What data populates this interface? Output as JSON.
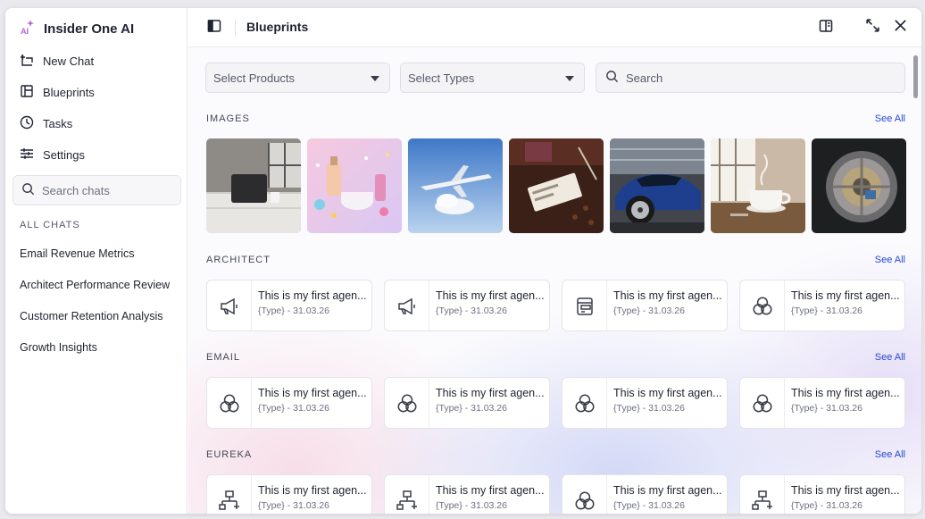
{
  "sidebar": {
    "brand_name": "Insider One AI",
    "nav": [
      {
        "label": "New Chat",
        "icon": "new-chat-icon"
      },
      {
        "label": "Blueprints",
        "icon": "blueprints-icon"
      },
      {
        "label": "Tasks",
        "icon": "clock-icon"
      },
      {
        "label": "Settings",
        "icon": "sliders-icon"
      }
    ],
    "search_placeholder": "Search chats",
    "chats_label": "ALL CHATS",
    "chats": [
      "Email Revenue Metrics",
      "Architect Performance Review",
      "Customer Retention Analysis",
      "Growth Insights"
    ]
  },
  "header": {
    "title": "Blueprints"
  },
  "filters": {
    "products_placeholder": "Select Products",
    "types_placeholder": "Select Types",
    "search_placeholder": "Search"
  },
  "sections": {
    "images": {
      "title": "IMAGES",
      "see_all": "See All"
    },
    "architect": {
      "title": "ARCHITECT",
      "see_all": "See All"
    },
    "email": {
      "title": "EMAIL",
      "see_all": "See All"
    },
    "eureka": {
      "title": "EUREKA",
      "see_all": "See All"
    }
  },
  "images": [
    "speaker-on-counter",
    "cosmetics-confetti",
    "airplane-in-sky",
    "tickets-on-table",
    "blue-sports-car",
    "coffee-cup-steam",
    "vault-door"
  ],
  "cards": {
    "title": "This is my first agen...",
    "subtitle": "{Type} - 31.03.26",
    "architect_icons": [
      "megaphone-icon",
      "megaphone-icon",
      "form-icon",
      "circles-icon"
    ],
    "email_icons": [
      "circles-icon",
      "circles-icon",
      "circles-icon",
      "circles-icon"
    ],
    "eureka_icons": [
      "flow-icon",
      "flow-icon",
      "circles-icon",
      "flow-icon"
    ]
  },
  "colors": {
    "accent_link": "#2447d6",
    "brand_sparkle_start": "#ff6aa8",
    "brand_sparkle_end": "#6a5cff"
  }
}
